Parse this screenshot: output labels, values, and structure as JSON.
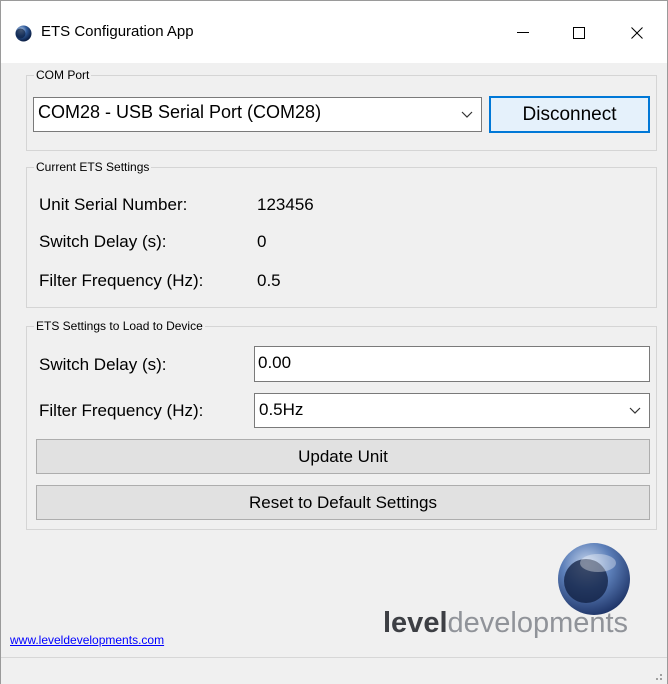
{
  "window": {
    "title": "ETS Configuration App"
  },
  "com_port": {
    "group_label": "COM Port",
    "selected": "COM28 - USB Serial Port (COM28)",
    "disconnect_label": "Disconnect"
  },
  "current": {
    "group_label": "Current ETS Settings",
    "serial_label": "Unit Serial Number:",
    "serial_value": "123456",
    "delay_label": "Switch Delay (s):",
    "delay_value": "0",
    "freq_label": "Filter Frequency (Hz):",
    "freq_value": "0.5"
  },
  "load": {
    "group_label": "ETS Settings to Load to Device",
    "delay_label": "Switch Delay (s):",
    "delay_value": "0.00",
    "freq_label": "Filter Frequency (Hz):",
    "freq_selected": "0.5Hz",
    "update_label": "Update Unit",
    "reset_label": "Reset to Default Settings"
  },
  "footer": {
    "website": "www.leveldevelopments.com",
    "logo_bold": "level",
    "logo_light": "developments"
  },
  "colors": {
    "accent": "#0078d7",
    "logo_dark": "#3d3f44",
    "logo_light": "#909399",
    "link": "#0000ff"
  }
}
